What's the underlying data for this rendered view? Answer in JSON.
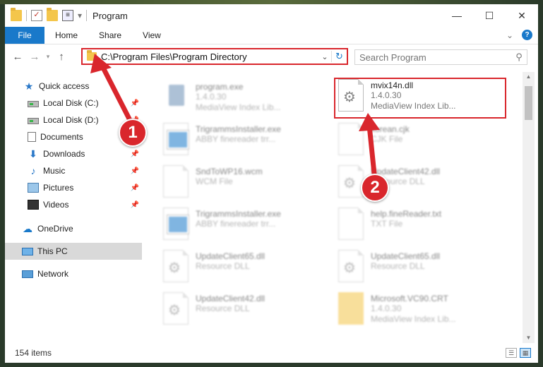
{
  "window": {
    "title": "Program",
    "controls": {
      "minimize": "—",
      "maximize": "☐",
      "close": "✕"
    }
  },
  "ribbon": {
    "tabs": [
      "File",
      "Home",
      "Share",
      "View"
    ],
    "help": "?"
  },
  "address_bar": {
    "path": "C:\\Program Files\\Program Directory",
    "search_placeholder": "Search Program"
  },
  "sidebar": {
    "items": [
      {
        "label": "Quick access",
        "icon": "star-icon"
      },
      {
        "label": "Local Disk (C:)",
        "icon": "disk-icon",
        "pinned": true
      },
      {
        "label": "Local Disk (D:)",
        "icon": "disk-icon",
        "pinned": true
      },
      {
        "label": "Documents",
        "icon": "documents-icon",
        "pinned": true
      },
      {
        "label": "Downloads",
        "icon": "downloads-icon",
        "pinned": true
      },
      {
        "label": "Music",
        "icon": "music-icon",
        "pinned": true
      },
      {
        "label": "Pictures",
        "icon": "pictures-icon",
        "pinned": true
      },
      {
        "label": "Videos",
        "icon": "videos-icon",
        "pinned": true
      },
      {
        "label": "OneDrive",
        "icon": "onedrive-icon"
      },
      {
        "label": "This PC",
        "icon": "this-pc-icon",
        "selected": true
      },
      {
        "label": "Network",
        "icon": "network-icon"
      }
    ]
  },
  "files": [
    {
      "name": "program.exe",
      "line2": "1.4.0.30",
      "line3": "MediaView Index Lib...",
      "thumb": "exe"
    },
    {
      "name": "mvix14n.dll",
      "line2": "1.4.0.30",
      "line3": "MediaView Index Lib...",
      "thumb": "dll",
      "highlighted": true
    },
    {
      "name": "TrigrammsInstaller.exe",
      "line2": "ABBY finereader trr...",
      "thumb": "app"
    },
    {
      "name": "korean.cjk",
      "line2": "CJK File",
      "thumb": "page"
    },
    {
      "name": "SndToWP16.wcm",
      "line2": "WCM File",
      "thumb": "page"
    },
    {
      "name": "UpdateClient42.dll",
      "line2": "Resource DLL",
      "thumb": "dll"
    },
    {
      "name": "TrigrammsInstaller.exe",
      "line2": "ABBY finereader trr...",
      "thumb": "app"
    },
    {
      "name": "help.fineReader.txt",
      "line2": "TXT File",
      "thumb": "page"
    },
    {
      "name": "UpdateClient65.dll",
      "line2": "Resource DLL",
      "thumb": "dll"
    },
    {
      "name": "UpdateClient65.dll",
      "line2": "Resource DLL",
      "thumb": "dll"
    },
    {
      "name": "UpdateClient42.dll",
      "line2": "Resource DLL",
      "thumb": "dll"
    },
    {
      "name": "Microsoft.VC90.CRT",
      "line2": "1.4.0.30",
      "line3": "MediaView Index Lib...",
      "thumb": "folder"
    }
  ],
  "status": {
    "item_count": "154 items"
  },
  "annotations": {
    "step1": "1",
    "step2": "2"
  },
  "colors": {
    "accent": "#1979ca",
    "highlight": "#d9262c"
  }
}
